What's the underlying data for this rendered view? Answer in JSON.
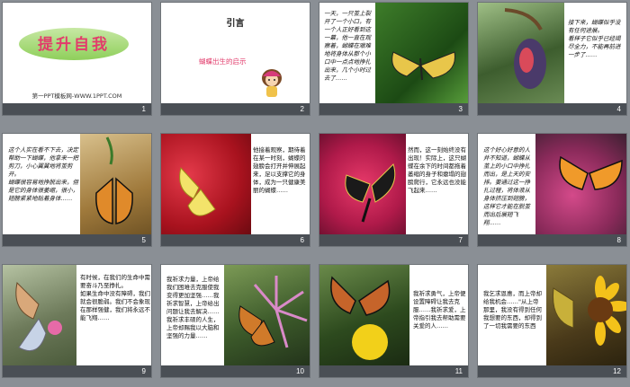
{
  "slides": [
    {
      "num": "1",
      "title": "提升自我",
      "subtitle": "第一PPT模板网-WWW.1PPT.COM"
    },
    {
      "num": "2",
      "title": "引言",
      "subtitle": "蝴蝶出生的启示"
    },
    {
      "num": "3",
      "text": "一天，一只茧上裂开了一个小口，有一个人正好看到这一幕，他一直在观察着，蝴蝶在艰难地将身体从那个小口中一点点地挣扎出来，几个小时过去了……"
    },
    {
      "num": "4",
      "text": "接下来，蝴蝶似乎没有任何进展。\n看样子它似乎已经竭尽全力，不能再前进一步了……"
    },
    {
      "num": "5",
      "text": "这个人实在看不下去，决定帮助一下蝴蝶，他拿来一把剪刀，小心翼翼地将茧剪开。\n蝴蝶很容易地挣脱出来，但是它的身体很萎缩，很小，翅膀紧紧地贴着身体……"
    },
    {
      "num": "6",
      "text": "他接着观察，期待着在某一时刻，蝴蝶的翅膀会打开并伸展起来，足以支撑它的身体，成为一只健康美丽的蝴蝶……"
    },
    {
      "num": "7",
      "text": "然而，这一刻始终没有出现！实际上，这只蝴蝶在余下的时间都拖着萎缩的身子和瘪塌的翅膀爬行，它永远也没能飞起来……"
    },
    {
      "num": "8",
      "text": "这个好心好意的人并不知道，蝴蝶从茧上的小口中挣扎而出，是上天的安排。要通过这一挣扎过程，将体液从身体挤压到翅膀，这样它才能在脱茧而出后展翅飞翔……"
    },
    {
      "num": "9",
      "text": "有时候，在我们的生命中需要奋斗乃至挣扎。\n如果生命中没有障碍，我们就会很脆弱。我们不会象现在那样强健，我们将永远不能飞翔……"
    },
    {
      "num": "10",
      "text": "我祈求力量，上帝给我们困难去克服使我变得更加坚强……我祈求智慧，上帝给出问题让我去解决……我祈求丰硕的人生，上帝却赐我以大脑和坚强的力量……"
    },
    {
      "num": "11",
      "text": "我祈求勇气，上帝便设置障碍让我去克服……我祈求爱，上帝指引我去帮助需要关爱的人……"
    },
    {
      "num": "12",
      "text": "我乞求恩惠，而上帝却给我机会……\"从上帝那里，我没有得到任何我想要的东西，却得到了一切我需要的东西"
    }
  ],
  "colors": {
    "title_pink": "#e23b6b",
    "banner_green": "#8fcf5b",
    "number_strip": "#4a4f55",
    "background": "#8a8f95"
  }
}
